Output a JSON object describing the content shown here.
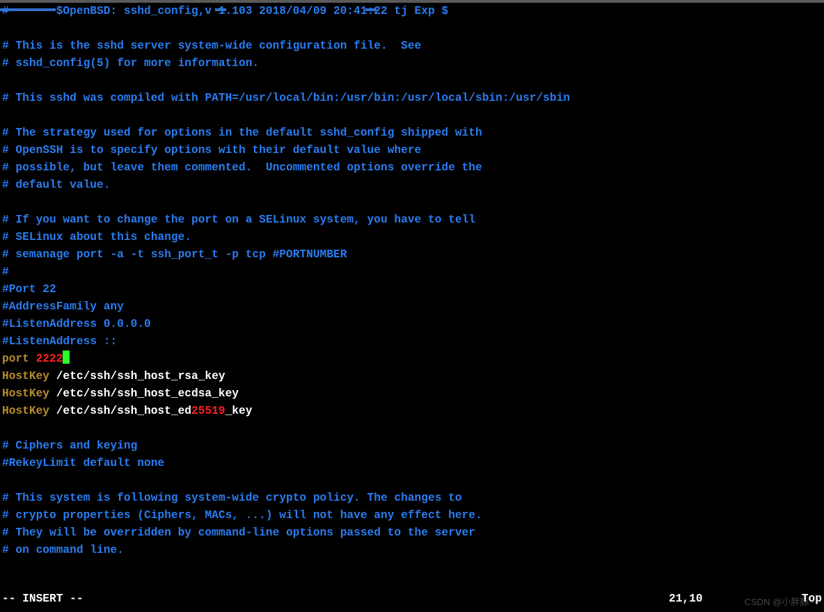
{
  "lines": [
    [
      [
        "cmt",
        "#       $OpenBSD: sshd_config,v 1.103 2018/04/09 20:41:22 tj Exp $"
      ]
    ],
    [],
    [
      [
        "cmt",
        "# This is the sshd server system-wide configuration file.  See"
      ]
    ],
    [
      [
        "cmt",
        "# sshd_config(5) for more information."
      ]
    ],
    [],
    [
      [
        "cmt",
        "# This sshd was compiled with PATH=/usr/local/bin:/usr/bin:/usr/local/sbin:/usr/sbin"
      ]
    ],
    [],
    [
      [
        "cmt",
        "# The strategy used for options in the default sshd_config shipped with"
      ]
    ],
    [
      [
        "cmt",
        "# OpenSSH is to specify options with their default value where"
      ]
    ],
    [
      [
        "cmt",
        "# possible, but leave them commented.  Uncommented options override the"
      ]
    ],
    [
      [
        "cmt",
        "# default value."
      ]
    ],
    [],
    [
      [
        "cmt",
        "# If you want to change the port on a SELinux system, you have to tell"
      ]
    ],
    [
      [
        "cmt",
        "# SELinux about this change."
      ]
    ],
    [
      [
        "cmt",
        "# semanage port -a -t ssh_port_t -p tcp #PORTNUMBER"
      ]
    ],
    [
      [
        "cmt",
        "#"
      ]
    ],
    [
      [
        "cmt",
        "#Port 22"
      ]
    ],
    [
      [
        "cmt",
        "#AddressFamily any"
      ]
    ],
    [
      [
        "cmt",
        "#ListenAddress 0.0.0.0"
      ]
    ],
    [
      [
        "cmt",
        "#ListenAddress ::"
      ]
    ],
    [
      [
        "kw",
        "port "
      ],
      [
        "num",
        "2222"
      ],
      [
        "cursor",
        ""
      ]
    ],
    [
      [
        "kw",
        "HostKey"
      ],
      [
        "txt",
        " /etc/ssh/ssh_host_rsa_key"
      ]
    ],
    [
      [
        "kw",
        "HostKey"
      ],
      [
        "txt",
        " /etc/ssh/ssh_host_ecdsa_key"
      ]
    ],
    [
      [
        "kw",
        "HostKey"
      ],
      [
        "txt",
        " /etc/ssh/ssh_host_ed"
      ],
      [
        "num",
        "25519"
      ],
      [
        "txt",
        "_key"
      ]
    ],
    [],
    [
      [
        "cmt",
        "# Ciphers and keying"
      ]
    ],
    [
      [
        "cmt",
        "#RekeyLimit default none"
      ]
    ],
    [],
    [
      [
        "cmt",
        "# This system is following system-wide crypto policy. The changes to"
      ]
    ],
    [
      [
        "cmt",
        "# crypto properties (Ciphers, MACs, ...) will not have any effect here."
      ]
    ],
    [
      [
        "cmt",
        "# They will be overridden by command-line options passed to the server"
      ]
    ],
    [
      [
        "cmt",
        "# on command line."
      ]
    ]
  ],
  "status": {
    "mode": "-- INSERT --",
    "pos": "21,10",
    "pct": "Top"
  },
  "watermark": "CSDN @小胖豚~"
}
